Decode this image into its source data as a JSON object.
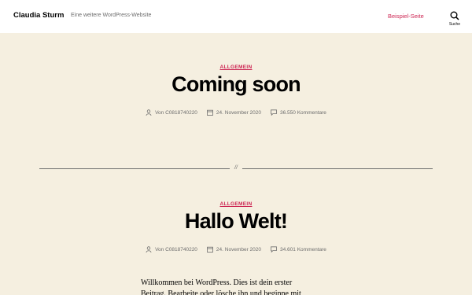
{
  "header": {
    "site_title": "Claudia Sturm",
    "site_description": "Eine weitere WordPress-Website",
    "nav_link": "Beispiel-Seite",
    "search_label": "Suche"
  },
  "posts": [
    {
      "category": "ALLGEMEIN",
      "title": "Coming soon",
      "author": "Von C0818740220",
      "date": "24. November 2020",
      "comments": "36.550 Kommentare"
    },
    {
      "category": "ALLGEMEIN",
      "title": "Hallo Welt!",
      "author": "Von C0818740220",
      "date": "24. November 2020",
      "comments": "34.601 Kommentare"
    }
  ],
  "separator_mark": "//",
  "content": {
    "line1": "Willkommen bei WordPress. Dies ist dein erster",
    "line2": "Beitrag. Bearbeite oder lösche ihn und beginne mit"
  },
  "colors": {
    "accent": "#cd2653",
    "background": "#f5efe0",
    "header_bg": "#ffffff",
    "meta": "#6d6d6d"
  },
  "icons": [
    "search-icon",
    "user-icon",
    "calendar-icon",
    "comment-icon"
  ]
}
